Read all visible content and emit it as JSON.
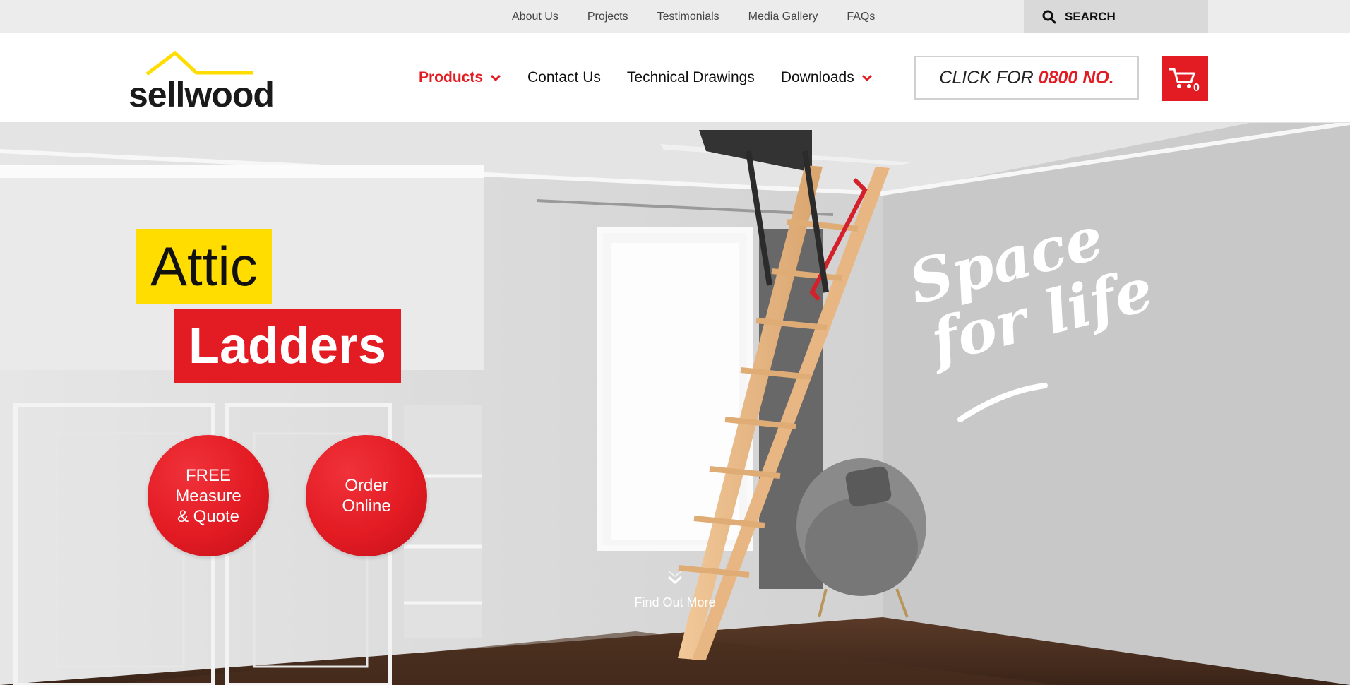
{
  "util_nav": {
    "links": [
      "About Us",
      "Projects",
      "Testimonials",
      "Media Gallery",
      "FAQs"
    ],
    "search_placeholder": "SEARCH",
    "search_icon": "search-icon"
  },
  "header": {
    "logo_text": "sellwood",
    "nav": [
      {
        "label": "Products",
        "dropdown": true,
        "active": true
      },
      {
        "label": "Contact Us",
        "dropdown": false
      },
      {
        "label": "Technical Drawings",
        "dropdown": false
      },
      {
        "label": "Downloads",
        "dropdown": true
      }
    ],
    "phone": {
      "prefix": "CLICK FOR",
      "number": "0800 NO."
    },
    "cart": {
      "icon": "cart-icon",
      "count": "0"
    }
  },
  "hero": {
    "headline_1": "Attic",
    "headline_2": "Ladders",
    "buttons": [
      {
        "label": "FREE\nMeasure\n& Quote"
      },
      {
        "label": "Order\nOnline"
      }
    ],
    "tagline_1": "Space",
    "tagline_2": "for life",
    "find_more": "Find Out More",
    "find_more_icon": "chevron-down-icon"
  },
  "colors": {
    "brand_red": "#e31b23",
    "brand_yellow": "#ffdd00",
    "util_bar": "#ececec"
  }
}
